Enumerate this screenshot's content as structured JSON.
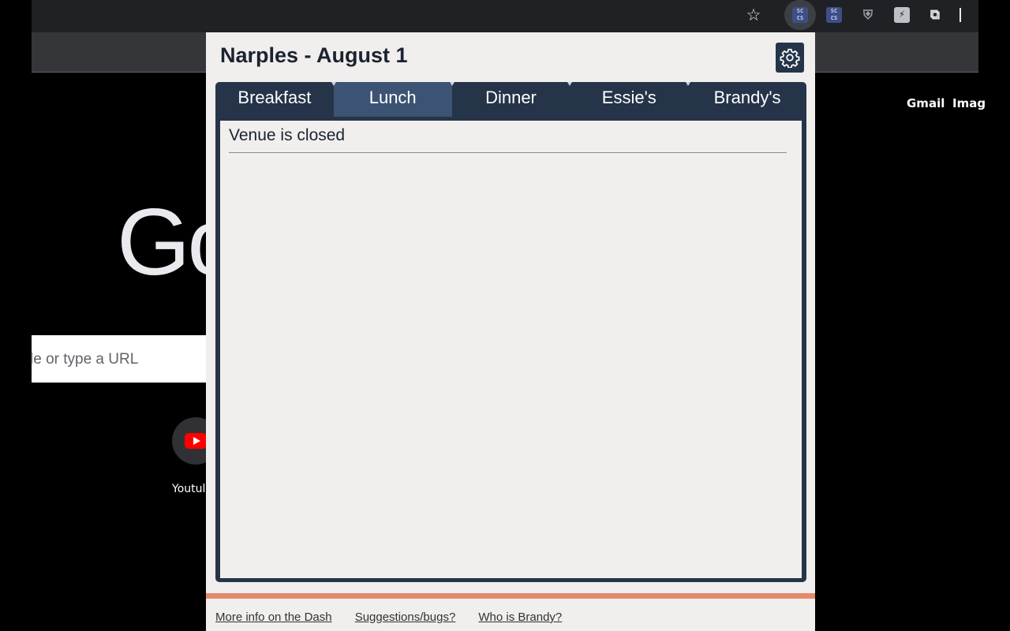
{
  "browser": {
    "extensions": [
      {
        "icon": "dash-extension-icon",
        "label": "SC\nCS"
      },
      {
        "icon": "dash-extension-icon-2",
        "label": "SC\nCS"
      },
      {
        "icon": "ublock-shield-icon",
        "label": "⛨"
      },
      {
        "icon": "bolt-extension-icon",
        "label": "⚡"
      },
      {
        "icon": "puzzle-icon",
        "label": "⧉"
      }
    ]
  },
  "ntp": {
    "links": [
      "Gmail",
      "Imag"
    ],
    "logo_text": "Go",
    "search_placeholder": "le or type a URL",
    "shortcut_label": "Youtul"
  },
  "popup": {
    "title": "Narples - August 1",
    "tabs": [
      {
        "label": "Breakfast",
        "active": false
      },
      {
        "label": "Lunch",
        "active": true
      },
      {
        "label": "Dinner",
        "active": false
      },
      {
        "label": "Essie's",
        "active": false
      },
      {
        "label": "Brandy's",
        "active": false
      }
    ],
    "status": "Venue is closed",
    "footer_links": [
      "More info on the Dash",
      "Suggestions/bugs?",
      "Who is Brandy?"
    ],
    "colors": {
      "panel": "#253449",
      "active_tab": "#3c5373",
      "accent_bar": "#e58b6a"
    }
  }
}
